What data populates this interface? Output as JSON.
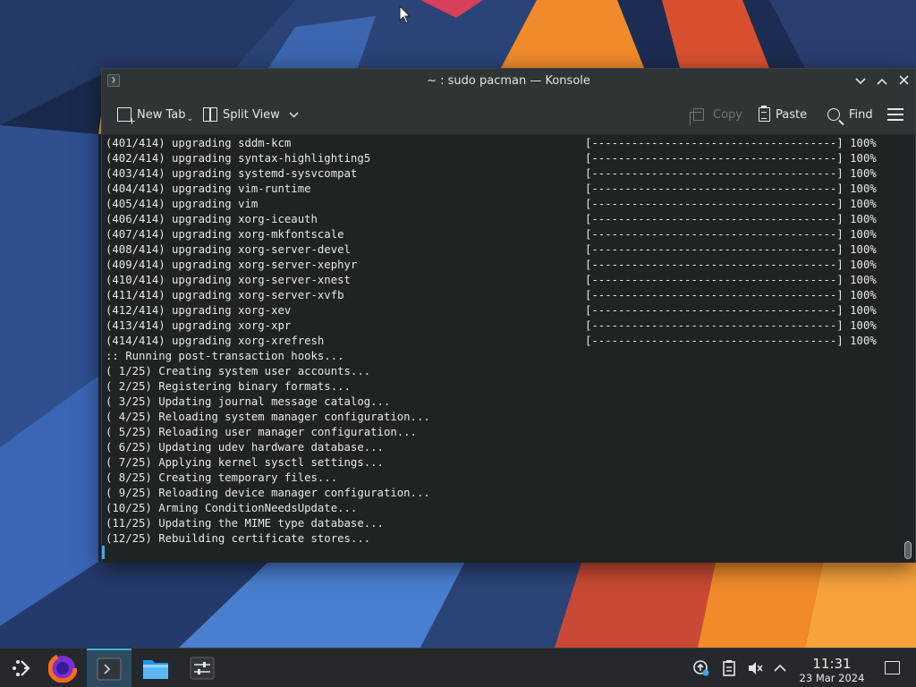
{
  "window": {
    "title": "~ : sudo pacman — Konsole",
    "app_icon": "❯"
  },
  "toolbar": {
    "new_tab_label": "New Tab",
    "split_view_label": "Split View",
    "copy_label": "Copy",
    "paste_label": "Paste",
    "find_label": "Find"
  },
  "terminal": {
    "lines": [
      "(401/414) upgrading sddm-kcm",
      "(402/414) upgrading syntax-highlighting5",
      "(403/414) upgrading systemd-sysvcompat",
      "(404/414) upgrading vim-runtime",
      "(405/414) upgrading vim",
      "(406/414) upgrading xorg-iceauth",
      "(407/414) upgrading xorg-mkfontscale",
      "(408/414) upgrading xorg-server-devel",
      "(409/414) upgrading xorg-server-xephyr",
      "(410/414) upgrading xorg-server-xnest",
      "(411/414) upgrading xorg-server-xvfb",
      "(412/414) upgrading xorg-xev",
      "(413/414) upgrading xorg-xpr",
      "(414/414) upgrading xorg-xrefresh",
      ":: Running post-transaction hooks...",
      "( 1/25) Creating system user accounts...",
      "( 2/25) Registering binary formats...",
      "( 3/25) Updating journal message catalog...",
      "( 4/25) Reloading system manager configuration...",
      "( 5/25) Reloading user manager configuration...",
      "( 6/25) Updating udev hardware database...",
      "( 7/25) Applying kernel sysctl settings...",
      "( 8/25) Creating temporary files...",
      "( 9/25) Reloading device manager configuration...",
      "(10/25) Arming ConditionNeedsUpdate...",
      "(11/25) Updating the MIME type database...",
      "(12/25) Rebuilding certificate stores..."
    ],
    "progress_bar": "[-------------------------------------] 100%",
    "progress_rows": 14
  },
  "taskbar": {
    "clock_time": "11:31",
    "clock_date": "23 Mar 2024",
    "accent": "#3daee9"
  }
}
